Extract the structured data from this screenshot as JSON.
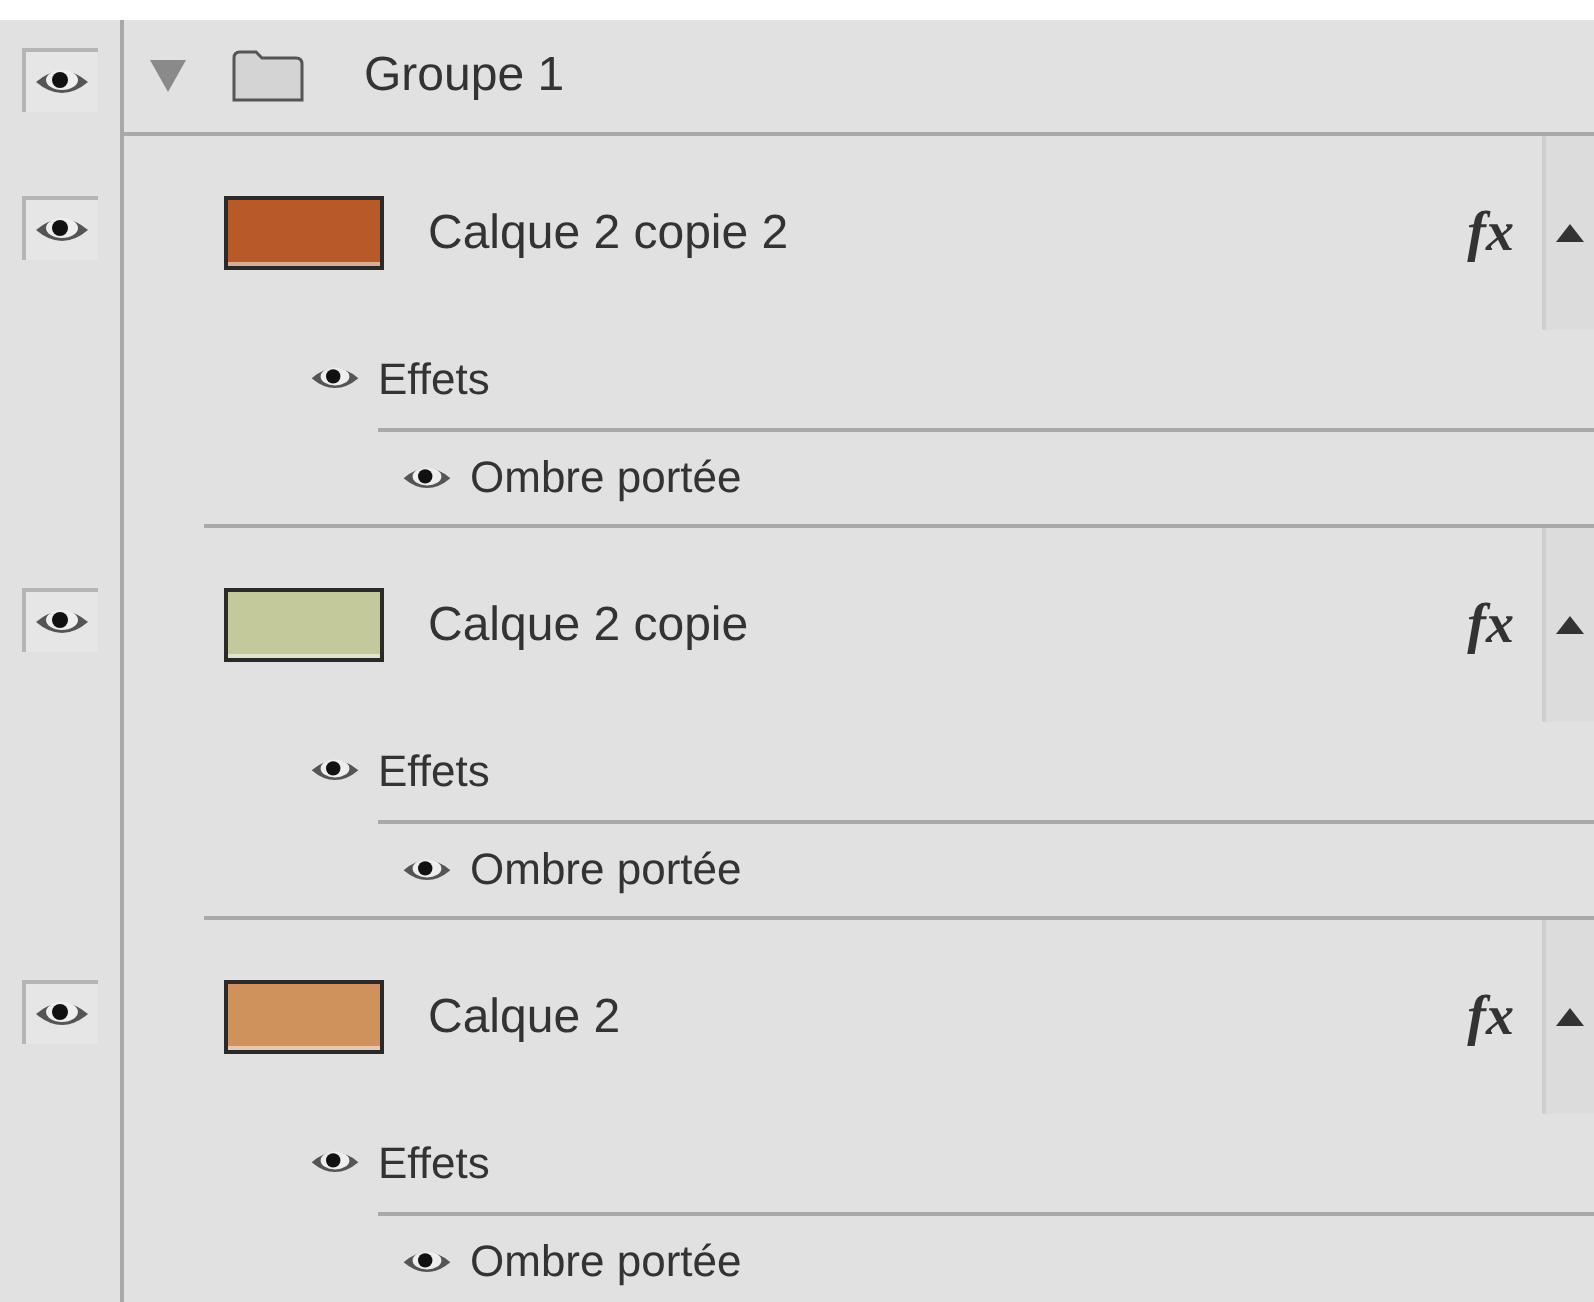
{
  "group": {
    "name": "Groupe 1",
    "visible": true,
    "expanded": true
  },
  "layers": [
    {
      "name": "Calque 2 copie 2",
      "color": "#b85a28",
      "visible": true,
      "fx": "fx",
      "effects_label": "Effets",
      "effects_visible": true,
      "effects": [
        {
          "name": "Ombre portée",
          "visible": true
        }
      ]
    },
    {
      "name": "Calque 2 copie",
      "color": "#c3c99a",
      "visible": true,
      "fx": "fx",
      "effects_label": "Effets",
      "effects_visible": true,
      "effects": [
        {
          "name": "Ombre portée",
          "visible": true
        }
      ]
    },
    {
      "name": "Calque 2",
      "color": "#d0925c",
      "visible": true,
      "fx": "fx",
      "effects_label": "Effets",
      "effects_visible": true,
      "effects": [
        {
          "name": "Ombre portée",
          "visible": true
        }
      ]
    }
  ]
}
